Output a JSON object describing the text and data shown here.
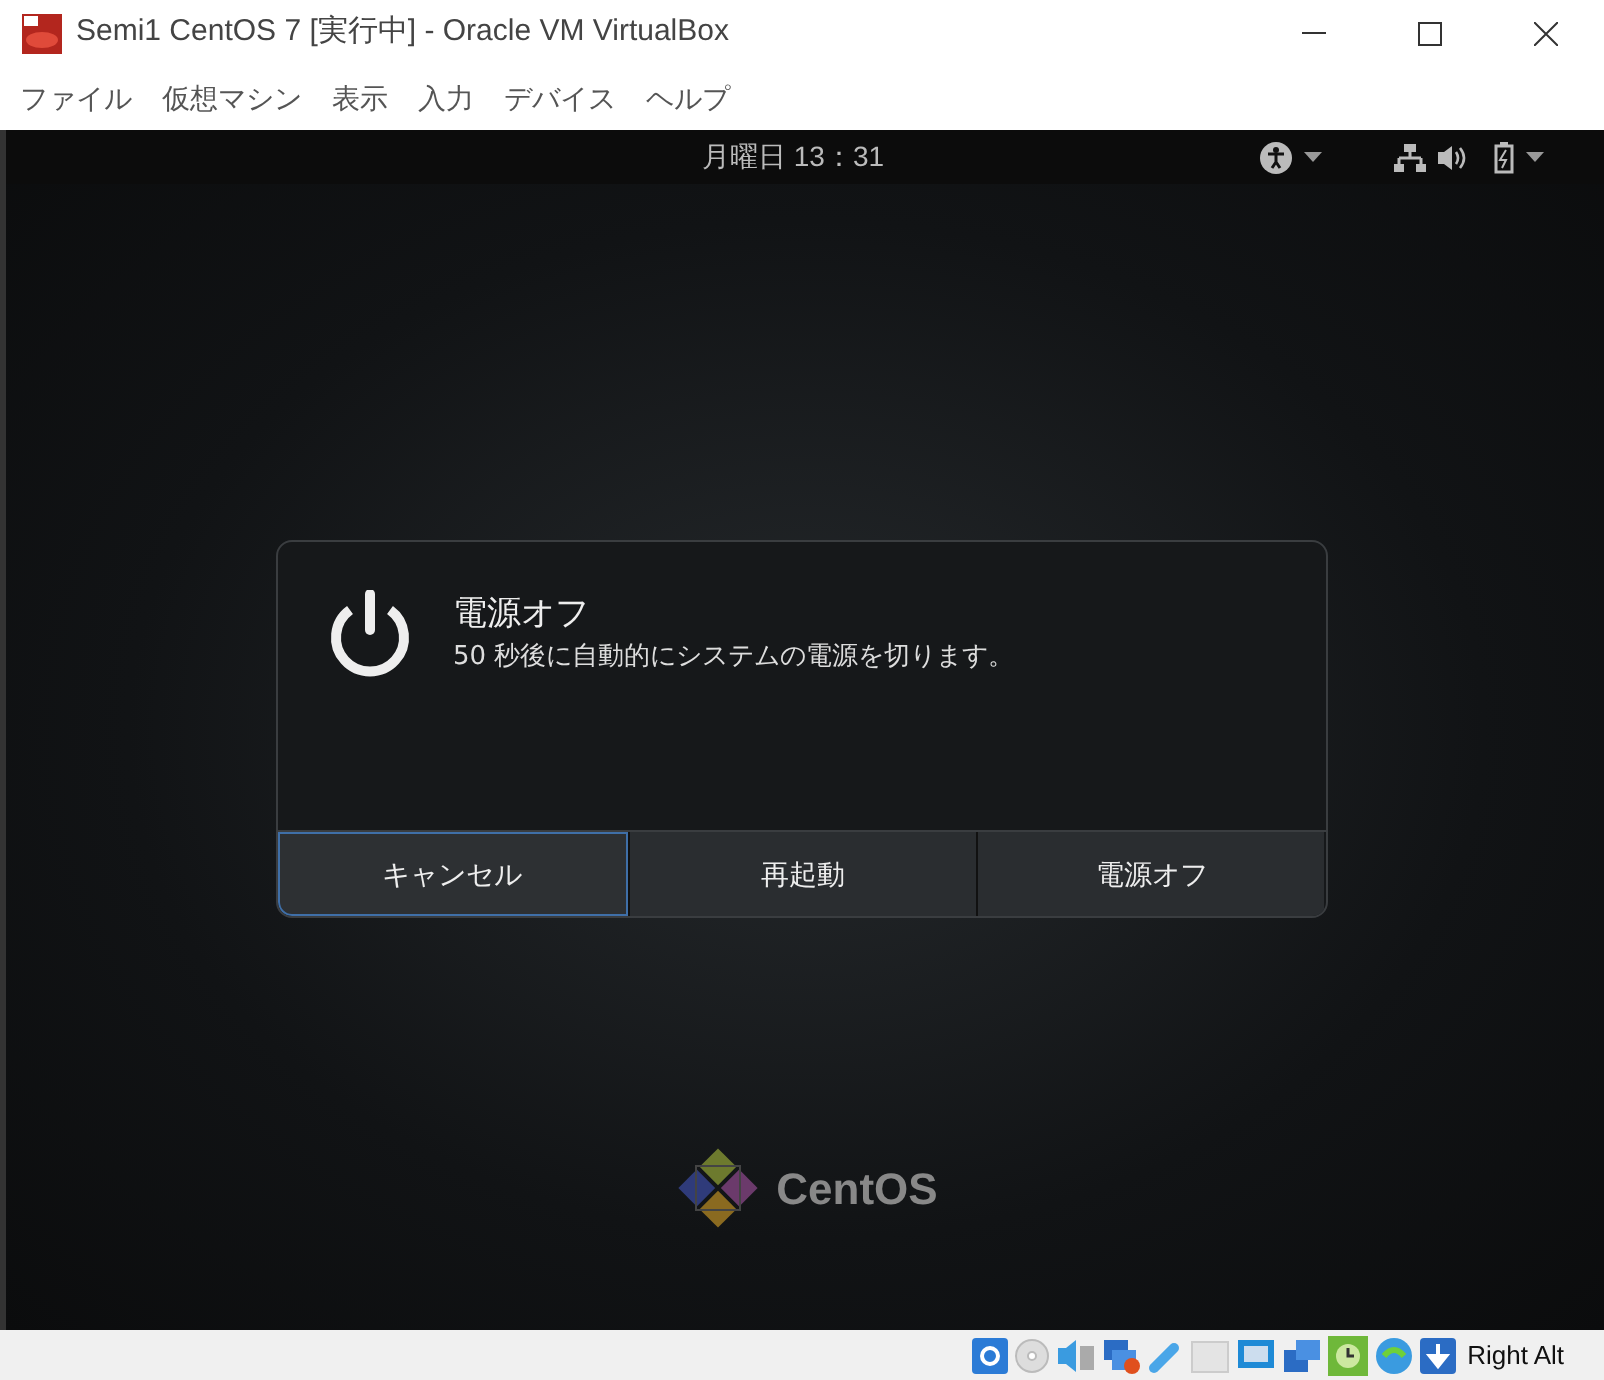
{
  "window": {
    "title": "Semi1 CentOS 7 [実行中] - Oracle VM VirtualBox"
  },
  "menu": [
    "ファイル",
    "仮想マシン",
    "表示",
    "入力",
    "デバイス",
    "ヘルプ"
  ],
  "top_bar": {
    "clock": "月曜日 13：31"
  },
  "dialog": {
    "title": "電源オフ",
    "message": "50 秒後に自動的にシステムの電源を切ります。",
    "buttons": [
      {
        "label": "キャンセル",
        "selected": true
      },
      {
        "label": "再起動",
        "selected": false
      },
      {
        "label": "電源オフ",
        "selected": false
      }
    ]
  },
  "logo": {
    "text": "CentOS"
  },
  "status_bar": {
    "host_key": "Right Alt"
  }
}
